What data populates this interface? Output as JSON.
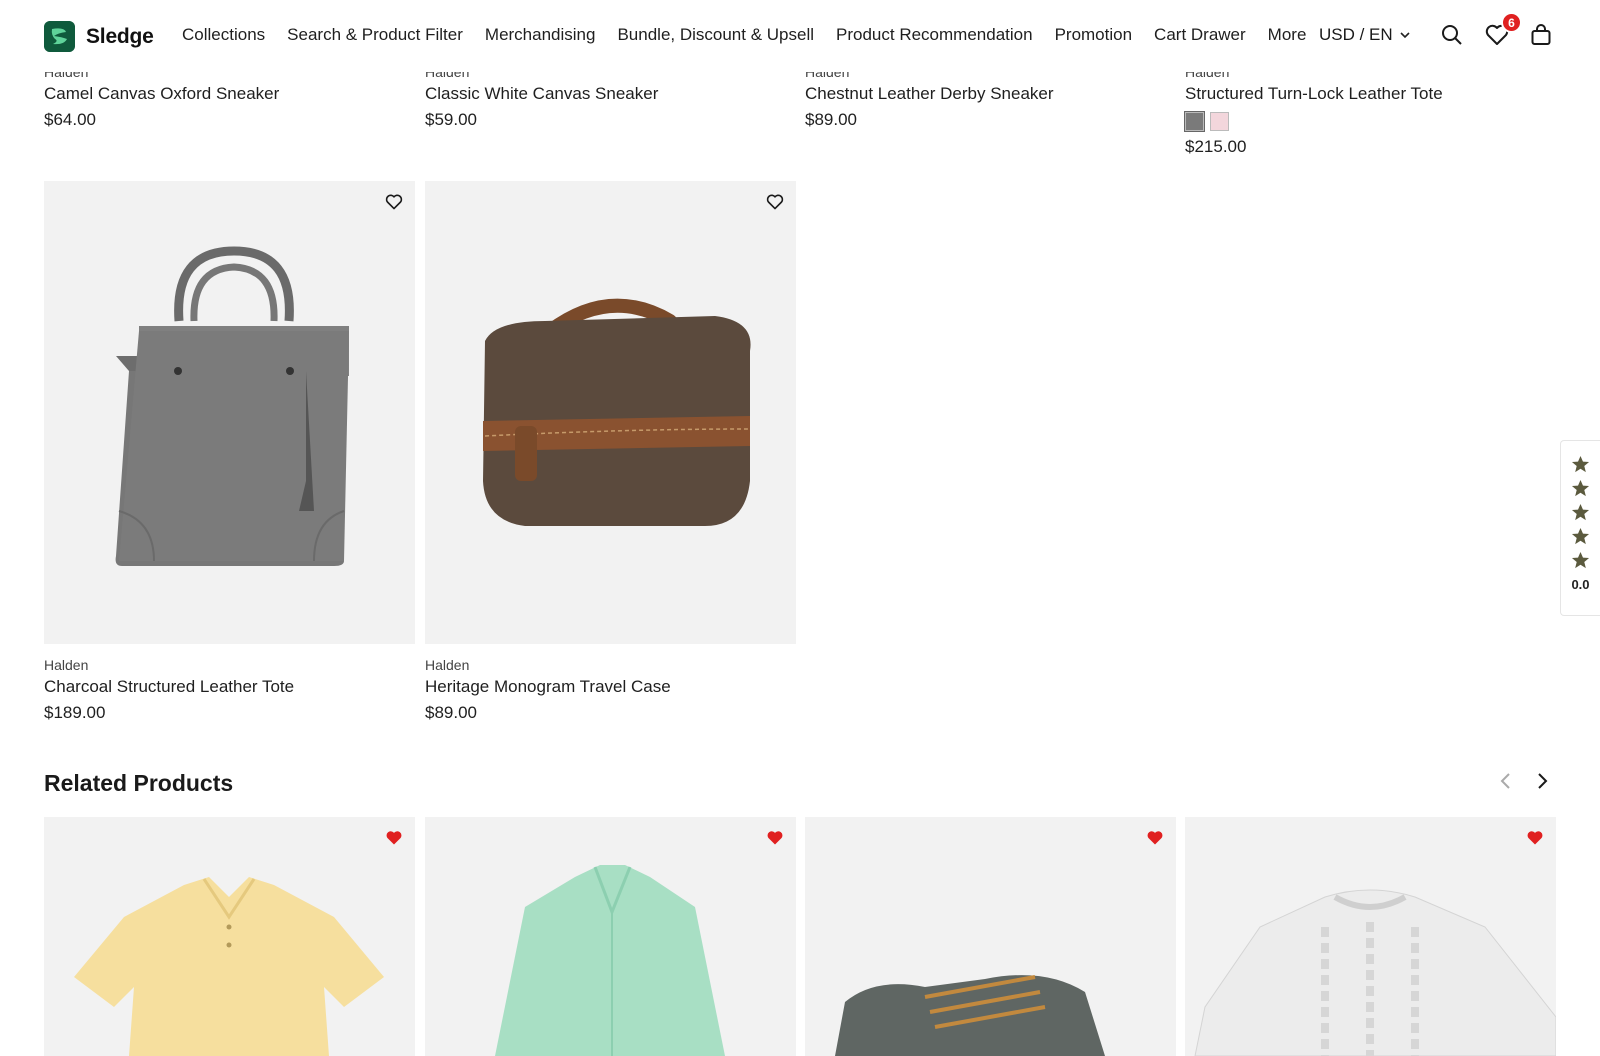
{
  "header": {
    "logo_text": "Sledge",
    "nav": [
      "Collections",
      "Search & Product Filter",
      "Merchandising",
      "Bundle, Discount & Upsell",
      "Product Recommendation",
      "Promotion",
      "Cart Drawer",
      "More"
    ],
    "currency": "USD / EN",
    "wishlist_count": "6"
  },
  "top_row": [
    {
      "brand": "Halden",
      "title": "Camel Canvas Oxford Sneaker",
      "price": "$64.00"
    },
    {
      "brand": "Halden",
      "title": "Classic White Canvas Sneaker",
      "price": "$59.00"
    },
    {
      "brand": "Halden",
      "title": "Chestnut Leather Derby Sneaker",
      "price": "$89.00"
    },
    {
      "brand": "Halden",
      "title": "Structured Turn-Lock Leather Tote",
      "price": "$215.00",
      "swatches": [
        "#7a7a7a",
        "#f3d6dc"
      ]
    }
  ],
  "products": [
    {
      "brand": "Halden",
      "title": "Charcoal Structured Leather Tote",
      "price": "$189.00"
    },
    {
      "brand": "Halden",
      "title": "Heritage Monogram Travel Case",
      "price": "$89.00"
    }
  ],
  "related": {
    "title": "Related Products",
    "items": [
      "polo-shirt-image",
      "mint-shirt-image",
      "grey-sneaker-image",
      "cable-knit-sweater-image"
    ]
  },
  "rating_tab": {
    "value": "0.0"
  },
  "colors": {
    "accent_red": "#e02020",
    "star": "#5b5a3e",
    "card_bg": "#f2f2f2"
  }
}
